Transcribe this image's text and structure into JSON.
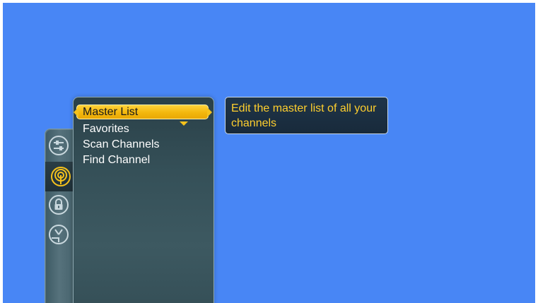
{
  "menu": {
    "items": [
      {
        "label": "Master List",
        "selected": true
      },
      {
        "label": "Favorites",
        "selected": false
      },
      {
        "label": "Scan Channels",
        "selected": false
      },
      {
        "label": "Find Channel",
        "selected": false
      }
    ]
  },
  "description": {
    "text": "Edit the master list of all your channels"
  },
  "rail": {
    "icons": [
      "settings-sliders-icon",
      "antenna-signal-icon",
      "lock-icon",
      "tv-antenna-icon"
    ],
    "selected_index": 1
  },
  "colors": {
    "background": "#4886f5",
    "highlight": "#f5c21c",
    "description_text": "#ffcf2e",
    "panel": "#355058"
  }
}
